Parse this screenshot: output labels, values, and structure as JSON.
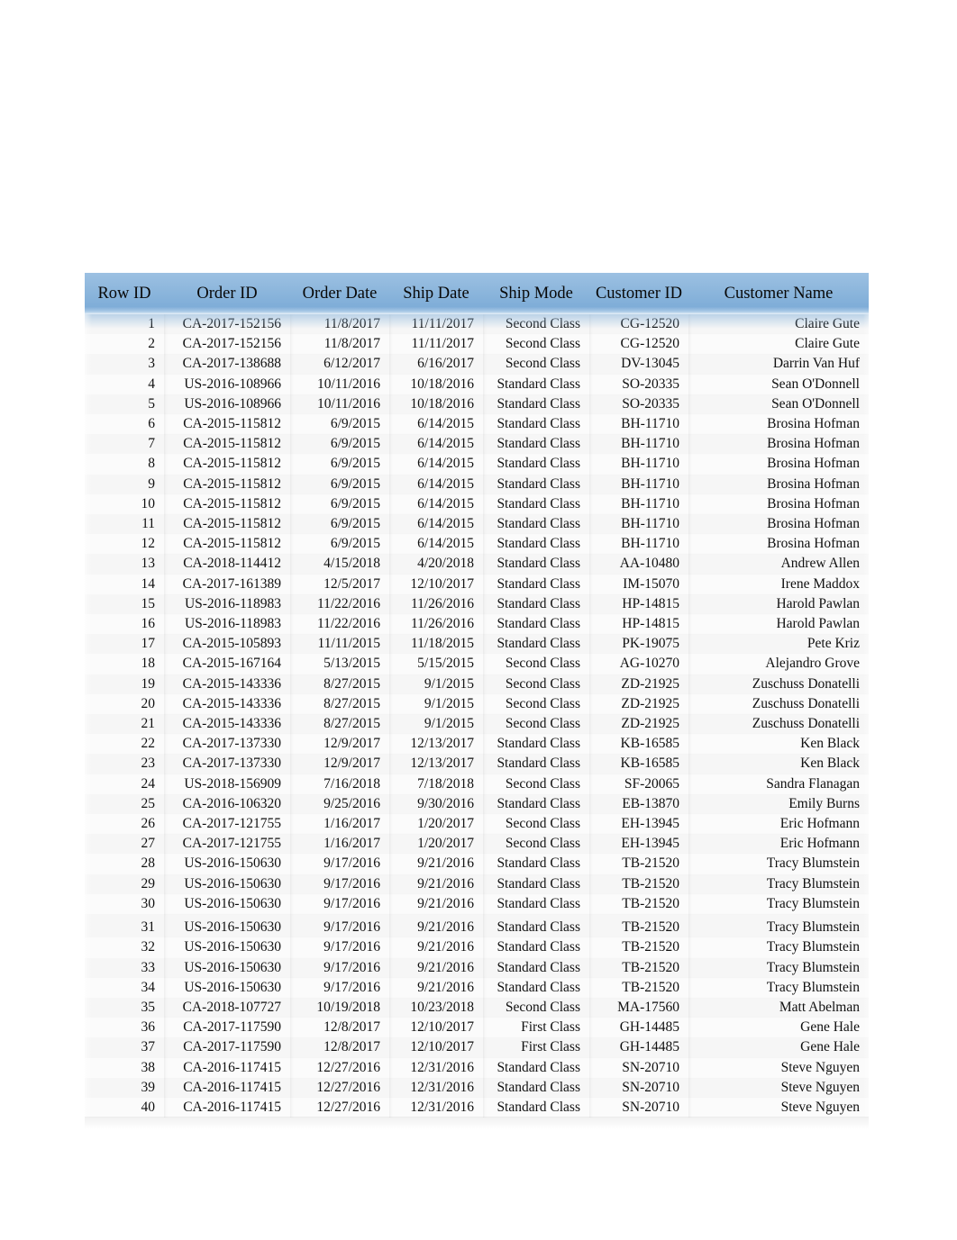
{
  "table": {
    "name": "orders-table",
    "accent_header_color": "#8cb6dc",
    "row_band_color": "#f6f6f6",
    "columns": [
      {
        "key": "row_id",
        "label": "Row ID"
      },
      {
        "key": "order_id",
        "label": "Order ID"
      },
      {
        "key": "order_date",
        "label": "Order Date"
      },
      {
        "key": "ship_date",
        "label": "Ship Date"
      },
      {
        "key": "ship_mode",
        "label": "Ship Mode"
      },
      {
        "key": "customer_id",
        "label": "Customer ID"
      },
      {
        "key": "customer_name",
        "label": "Customer Name"
      }
    ],
    "rows": [
      [
        "1",
        "CA-2017-152156",
        "11/8/2017",
        "11/11/2017",
        "Second Class",
        "CG-12520",
        "Claire Gute"
      ],
      [
        "2",
        "CA-2017-152156",
        "11/8/2017",
        "11/11/2017",
        "Second Class",
        "CG-12520",
        "Claire Gute"
      ],
      [
        "3",
        "CA-2017-138688",
        "6/12/2017",
        "6/16/2017",
        "Second Class",
        "DV-13045",
        "Darrin Van Huf"
      ],
      [
        "4",
        "US-2016-108966",
        "10/11/2016",
        "10/18/2016",
        "Standard Class",
        "SO-20335",
        "Sean O'Donnell"
      ],
      [
        "5",
        "US-2016-108966",
        "10/11/2016",
        "10/18/2016",
        "Standard Class",
        "SO-20335",
        "Sean O'Donnell"
      ],
      [
        "6",
        "CA-2015-115812",
        "6/9/2015",
        "6/14/2015",
        "Standard Class",
        "BH-11710",
        "Brosina Hofman"
      ],
      [
        "7",
        "CA-2015-115812",
        "6/9/2015",
        "6/14/2015",
        "Standard Class",
        "BH-11710",
        "Brosina Hofman"
      ],
      [
        "8",
        "CA-2015-115812",
        "6/9/2015",
        "6/14/2015",
        "Standard Class",
        "BH-11710",
        "Brosina Hofman"
      ],
      [
        "9",
        "CA-2015-115812",
        "6/9/2015",
        "6/14/2015",
        "Standard Class",
        "BH-11710",
        "Brosina Hofman"
      ],
      [
        "10",
        "CA-2015-115812",
        "6/9/2015",
        "6/14/2015",
        "Standard Class",
        "BH-11710",
        "Brosina Hofman"
      ],
      [
        "11",
        "CA-2015-115812",
        "6/9/2015",
        "6/14/2015",
        "Standard Class",
        "BH-11710",
        "Brosina Hofman"
      ],
      [
        "12",
        "CA-2015-115812",
        "6/9/2015",
        "6/14/2015",
        "Standard Class",
        "BH-11710",
        "Brosina Hofman"
      ],
      [
        "13",
        "CA-2018-114412",
        "4/15/2018",
        "4/20/2018",
        "Standard Class",
        "AA-10480",
        "Andrew Allen"
      ],
      [
        "14",
        "CA-2017-161389",
        "12/5/2017",
        "12/10/2017",
        "Standard Class",
        "IM-15070",
        "Irene Maddox"
      ],
      [
        "15",
        "US-2016-118983",
        "11/22/2016",
        "11/26/2016",
        "Standard Class",
        "HP-14815",
        "Harold Pawlan"
      ],
      [
        "16",
        "US-2016-118983",
        "11/22/2016",
        "11/26/2016",
        "Standard Class",
        "HP-14815",
        "Harold Pawlan"
      ],
      [
        "17",
        "CA-2015-105893",
        "11/11/2015",
        "11/18/2015",
        "Standard Class",
        "PK-19075",
        "Pete Kriz"
      ],
      [
        "18",
        "CA-2015-167164",
        "5/13/2015",
        "5/15/2015",
        "Second Class",
        "AG-10270",
        "Alejandro Grove"
      ],
      [
        "19",
        "CA-2015-143336",
        "8/27/2015",
        "9/1/2015",
        "Second Class",
        "ZD-21925",
        "Zuschuss Donatelli"
      ],
      [
        "20",
        "CA-2015-143336",
        "8/27/2015",
        "9/1/2015",
        "Second Class",
        "ZD-21925",
        "Zuschuss Donatelli"
      ],
      [
        "21",
        "CA-2015-143336",
        "8/27/2015",
        "9/1/2015",
        "Second Class",
        "ZD-21925",
        "Zuschuss Donatelli"
      ],
      [
        "22",
        "CA-2017-137330",
        "12/9/2017",
        "12/13/2017",
        "Standard Class",
        "KB-16585",
        "Ken Black"
      ],
      [
        "23",
        "CA-2017-137330",
        "12/9/2017",
        "12/13/2017",
        "Standard Class",
        "KB-16585",
        "Ken Black"
      ],
      [
        "24",
        "US-2018-156909",
        "7/16/2018",
        "7/18/2018",
        "Second Class",
        "SF-20065",
        "Sandra Flanagan"
      ],
      [
        "25",
        "CA-2016-106320",
        "9/25/2016",
        "9/30/2016",
        "Standard Class",
        "EB-13870",
        "Emily Burns"
      ],
      [
        "26",
        "CA-2017-121755",
        "1/16/2017",
        "1/20/2017",
        "Second Class",
        "EH-13945",
        "Eric Hofmann"
      ],
      [
        "27",
        "CA-2017-121755",
        "1/16/2017",
        "1/20/2017",
        "Second Class",
        "EH-13945",
        "Eric Hofmann"
      ],
      [
        "28",
        "US-2016-150630",
        "9/17/2016",
        "9/21/2016",
        "Standard Class",
        "TB-21520",
        "Tracy Blumstein"
      ],
      [
        "29",
        "US-2016-150630",
        "9/17/2016",
        "9/21/2016",
        "Standard Class",
        "TB-21520",
        "Tracy Blumstein"
      ],
      [
        "30",
        "US-2016-150630",
        "9/17/2016",
        "9/21/2016",
        "Standard Class",
        "TB-21520",
        "Tracy Blumstein"
      ],
      [
        "31",
        "US-2016-150630",
        "9/17/2016",
        "9/21/2016",
        "Standard Class",
        "TB-21520",
        "Tracy Blumstein"
      ],
      [
        "32",
        "US-2016-150630",
        "9/17/2016",
        "9/21/2016",
        "Standard Class",
        "TB-21520",
        "Tracy Blumstein"
      ],
      [
        "33",
        "US-2016-150630",
        "9/17/2016",
        "9/21/2016",
        "Standard Class",
        "TB-21520",
        "Tracy Blumstein"
      ],
      [
        "34",
        "US-2016-150630",
        "9/17/2016",
        "9/21/2016",
        "Standard Class",
        "TB-21520",
        "Tracy Blumstein"
      ],
      [
        "35",
        "CA-2018-107727",
        "10/19/2018",
        "10/23/2018",
        "Second Class",
        "MA-17560",
        "Matt Abelman"
      ],
      [
        "36",
        "CA-2017-117590",
        "12/8/2017",
        "12/10/2017",
        "First Class",
        "GH-14485",
        "Gene Hale"
      ],
      [
        "37",
        "CA-2017-117590",
        "12/8/2017",
        "12/10/2017",
        "First Class",
        "GH-14485",
        "Gene Hale"
      ],
      [
        "38",
        "CA-2016-117415",
        "12/27/2016",
        "12/31/2016",
        "Standard Class",
        "SN-20710",
        "Steve Nguyen"
      ],
      [
        "39",
        "CA-2016-117415",
        "12/27/2016",
        "12/31/2016",
        "Standard Class",
        "SN-20710",
        "Steve Nguyen"
      ],
      [
        "40",
        "CA-2016-117415",
        "12/27/2016",
        "12/31/2016",
        "Standard Class",
        "SN-20710",
        "Steve Nguyen"
      ]
    ]
  }
}
